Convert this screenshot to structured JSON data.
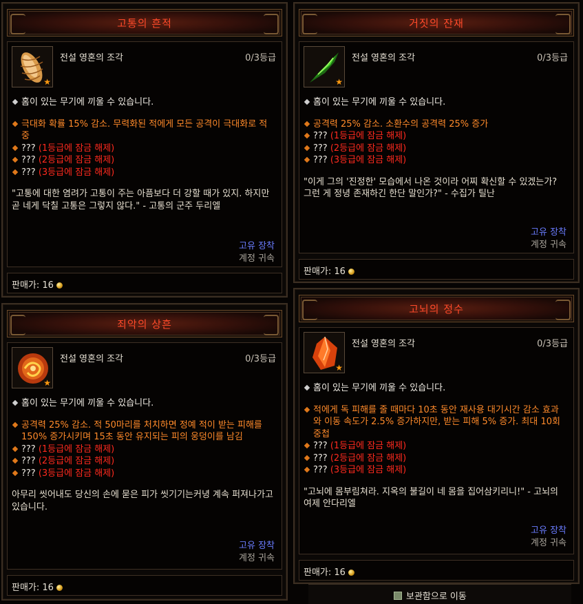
{
  "tooltips": [
    {
      "title": "고통의 흔적",
      "type": "전설 영혼의 조각",
      "rank": "0/3등급",
      "socket": "홈이 있는 무기에 끼울 수 있습니다.",
      "effect": "극대화 확률 15% 감소. 무력화된 적에게 모든 공격이 극대화로 적중",
      "locked": [
        {
          "q": "???",
          "note": "(1등급에 잠금 해제)"
        },
        {
          "q": "???",
          "note": "(2등급에 잠금 해제)"
        },
        {
          "q": "???",
          "note": "(3등급에 잠금 해제)"
        }
      ],
      "flavor": "\"고통에 대한 염려가 고통이 주는 아픔보다 더 강할 때가 있지. 하지만 곧 네게 닥칠 고통은 그렇지 않다.\" - 고통의 군주 두리엘",
      "quality": "고유 장착",
      "bind": "계정 귀속",
      "sell": "판매가: 16",
      "icon": "larva-icon"
    },
    {
      "title": "거짓의 잔재",
      "type": "전설 영혼의 조각",
      "rank": "0/3등급",
      "socket": "홈이 있는 무기에 끼울 수 있습니다.",
      "effect": "공격력 25% 감소. 소환수의 공격력 25% 증가",
      "locked": [
        {
          "q": "???",
          "note": "(1등급에 잠금 해제)"
        },
        {
          "q": "???",
          "note": "(2등급에 잠금 해제)"
        },
        {
          "q": "???",
          "note": "(3등급에 잠금 해제)"
        }
      ],
      "flavor": "\"이게 그의 '진정한' 모습에서 나온 것이라 어찌 확신할 수 있겠는가? 그런 게 정녕 존재하긴 한단 말인가?\" - 수집가 틸난",
      "quality": "고유 장착",
      "bind": "계정 귀속",
      "sell": "판매가: 16",
      "icon": "green-shard-icon"
    },
    {
      "title": "죄악의 상흔",
      "type": "전설 영혼의 조각",
      "rank": "0/3등급",
      "socket": "홈이 있는 무기에 끼울 수 있습니다.",
      "effect": "공격력 25% 감소. 적 50마리를 처치하면 정예 적이 받는 피해를 150% 증가시키며 15초 동안 유지되는 피의 웅덩이를 남김",
      "locked": [
        {
          "q": "???",
          "note": "(1등급에 잠금 해제)"
        },
        {
          "q": "???",
          "note": "(2등급에 잠금 해제)"
        },
        {
          "q": "???",
          "note": "(3등급에 잠금 해제)"
        }
      ],
      "flavor": "아무리 씻어내도 당신의 손에 묻은 피가 씻기기는커녕 계속 퍼져나가고 있습니다.",
      "quality": "고유 장착",
      "bind": "계정 귀속",
      "sell": "판매가: 16",
      "icon": "fire-orb-icon"
    },
    {
      "title": "고뇌의 정수",
      "type": "전설 영혼의 조각",
      "rank": "0/3등급",
      "socket": "홈이 있는 무기에 끼울 수 있습니다.",
      "effect": "적에게 독 피해를 줄 때마다 10초 동안 재사용 대기시간 감소 효과와 이동 속도가 2.5% 증가하지만, 받는 피해 5% 증가. 최대 10회 중첩",
      "locked": [
        {
          "q": "???",
          "note": "(1등급에 잠금 해제)"
        },
        {
          "q": "???",
          "note": "(2등급에 잠금 해제)"
        },
        {
          "q": "???",
          "note": "(3등급에 잠금 해제)"
        }
      ],
      "flavor": "\"고뇌에 몸부림쳐라. 지옥의 불길이 네 몸을 집어삼키리니!\" - 고뇌의 여제 안다리엘",
      "quality": "고유 장착",
      "bind": "계정 귀속",
      "sell": "판매가: 16",
      "icon": "orange-crystal-icon"
    }
  ],
  "stash": {
    "label": "보관함으로 이동",
    "icon": "stash-icon"
  },
  "colors": {
    "title": "#ff4a2a",
    "effect": "#ff8a2a",
    "locked": "#ff2a1e",
    "quality": "#6a7cff"
  }
}
